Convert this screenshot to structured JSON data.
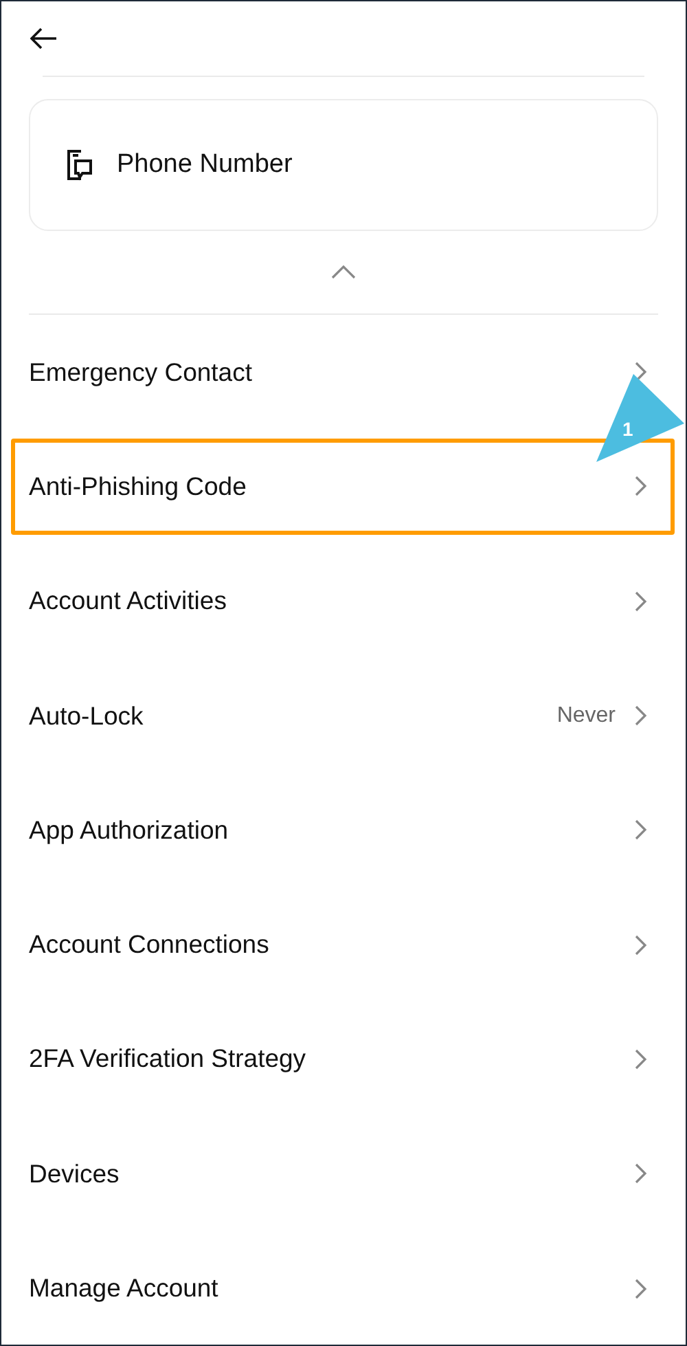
{
  "card": {
    "label": "Phone Number"
  },
  "menu": [
    {
      "label": "Emergency Contact",
      "highlighted": false
    },
    {
      "label": "Anti-Phishing Code",
      "highlighted": true
    },
    {
      "label": "Account Activities",
      "highlighted": false
    },
    {
      "label": "Auto-Lock",
      "value": "Never",
      "highlighted": false
    },
    {
      "label": "App Authorization",
      "highlighted": false
    },
    {
      "label": "Account Connections",
      "highlighted": false
    },
    {
      "label": "2FA Verification Strategy",
      "highlighted": false
    },
    {
      "label": "Devices",
      "highlighted": false
    },
    {
      "label": "Manage Account",
      "highlighted": false
    }
  ],
  "annotation": {
    "number": "1"
  }
}
